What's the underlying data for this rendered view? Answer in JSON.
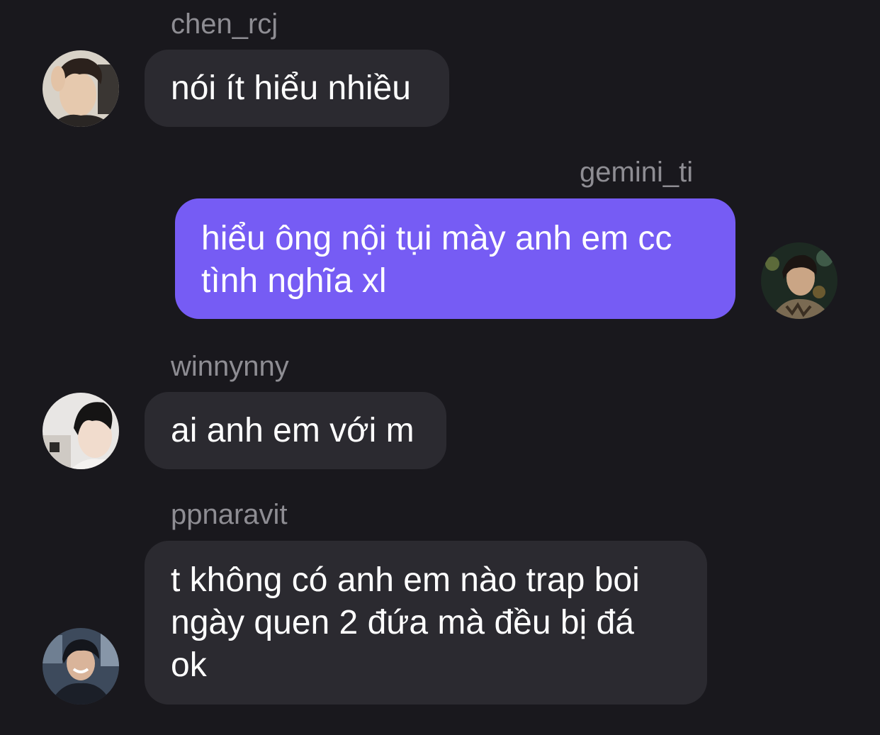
{
  "messages": [
    {
      "sender": "chen_rcj",
      "direction": "incoming",
      "lines": [
        "nói ít hiểu nhiều"
      ]
    },
    {
      "sender": "gemini_ti",
      "direction": "outgoing",
      "lines": [
        "hiểu ông nội tụi mày anh em cc",
        "tình nghĩa xl"
      ]
    },
    {
      "sender": "winnynny",
      "direction": "incoming",
      "lines": [
        "ai anh em với m"
      ]
    },
    {
      "sender": "ppnaravit",
      "direction": "incoming",
      "lines": [
        "t không có anh em nào trap boi",
        "ngày quen 2 đứa mà đều bị đá",
        "ok"
      ]
    }
  ],
  "colors": {
    "background": "#19181d",
    "incoming_bubble": "#2b2a30",
    "outgoing_bubble": "#765cf4",
    "username_text": "#8e8d93",
    "message_text": "#ffffff"
  }
}
